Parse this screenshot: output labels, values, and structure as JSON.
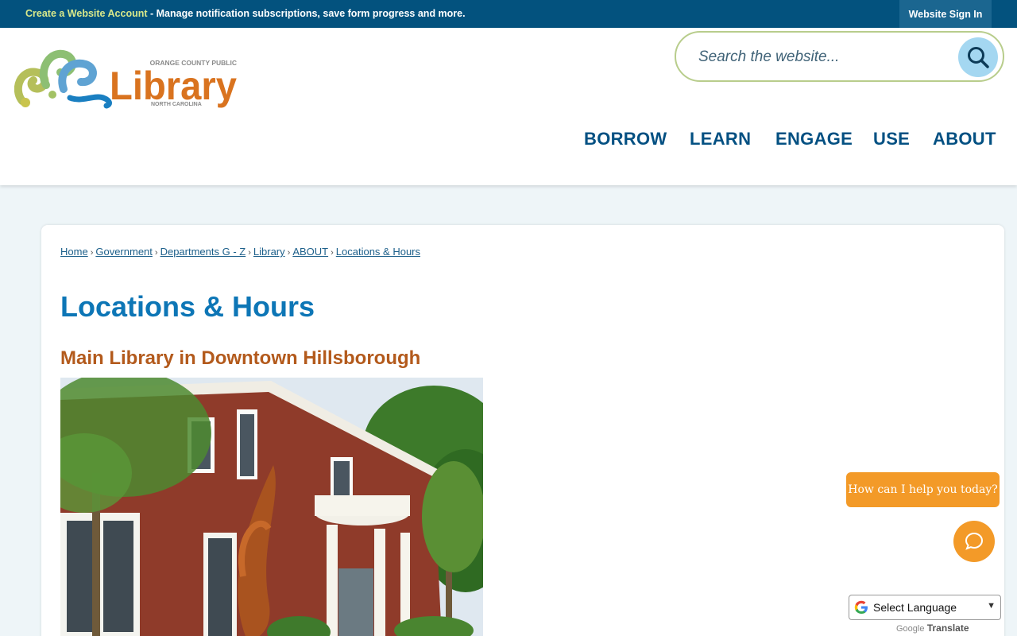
{
  "topbar": {
    "create_account_link": "Create a Website Account",
    "create_account_desc": " - Manage notification subscriptions, save form progress and more.",
    "sign_in_label": "Website Sign In"
  },
  "logo": {
    "top_text": "ORANGE COUNTY PUBLIC",
    "main_text": "Library",
    "bottom_text": "NORTH CAROLINA"
  },
  "search": {
    "placeholder": "Search the website..."
  },
  "nav": {
    "items": [
      "BORROW",
      "LEARN",
      "ENGAGE",
      "USE",
      "ABOUT"
    ]
  },
  "breadcrumb": {
    "items": [
      "Home",
      "Government",
      "Departments G - Z",
      "Library",
      "ABOUT",
      "Locations & Hours"
    ],
    "separator": "›"
  },
  "page": {
    "title": "Locations & Hours",
    "section_title": "Main Library in Downtown Hillsborough"
  },
  "chat": {
    "prompt": "How can I help you today?"
  },
  "translate": {
    "select_label": "Select Language",
    "powered_by": "Google",
    "translate_label": "Translate"
  },
  "colors": {
    "topbar": "#03527e",
    "nav_text": "#035082",
    "title_blue": "#0d76b6",
    "section_orange": "#b35a1c",
    "chat_orange": "#f39a28"
  }
}
